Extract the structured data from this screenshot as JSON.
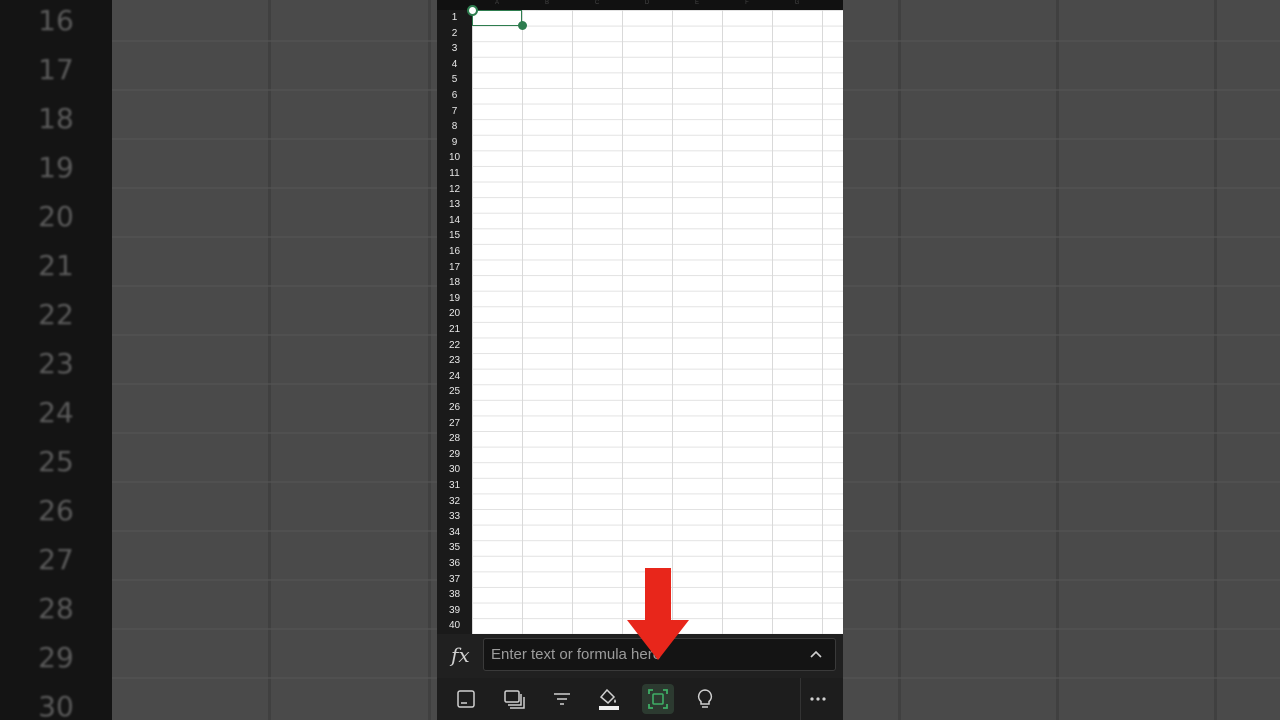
{
  "background": {
    "row_numbers": [
      "16",
      "17",
      "18",
      "19",
      "20",
      "21",
      "22",
      "23",
      "24",
      "25",
      "26",
      "27",
      "28",
      "29",
      "30"
    ]
  },
  "sheet": {
    "column_letters": [
      "A",
      "B",
      "C",
      "D",
      "E",
      "F",
      "G"
    ],
    "row_numbers": [
      "1",
      "2",
      "3",
      "4",
      "5",
      "6",
      "7",
      "8",
      "9",
      "10",
      "11",
      "12",
      "13",
      "14",
      "15",
      "16",
      "17",
      "18",
      "19",
      "20",
      "21",
      "22",
      "23",
      "24",
      "25",
      "26",
      "27",
      "28",
      "29",
      "30",
      "31",
      "32",
      "33",
      "34",
      "35",
      "36",
      "37",
      "38",
      "39",
      "40"
    ],
    "selected_cell": "A1"
  },
  "formula_bar": {
    "fx_label": "fx",
    "placeholder": "Enter text or formula here"
  },
  "toolbar": {
    "buttons": [
      {
        "icon": "card-view-icon"
      },
      {
        "icon": "sheets-icon"
      },
      {
        "icon": "filter-icon"
      },
      {
        "icon": "fill-color-icon"
      },
      {
        "icon": "select-range-icon",
        "active": true
      },
      {
        "icon": "ideas-lightbulb-icon"
      },
      {
        "icon": "more-options-icon"
      }
    ]
  },
  "colors": {
    "accent": "#2e7d4f",
    "arrow": "#e8261b"
  }
}
